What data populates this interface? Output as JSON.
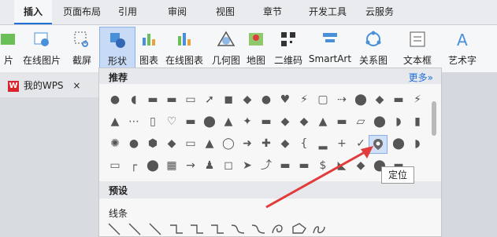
{
  "tabs": [
    "插入",
    "页面布局",
    "引用",
    "审阅",
    "视图",
    "章节",
    "开发工具",
    "云服务"
  ],
  "active_tab": "插入",
  "ribbon": [
    "片",
    "在线图片",
    "截屏",
    "形状",
    "图表",
    "在线图表",
    "几何图",
    "地图",
    "二维码",
    "SmartArt",
    "关系图",
    "文本框",
    "艺术字"
  ],
  "doc_tab": {
    "label": "我的WPS",
    "close": "×"
  },
  "panel": {
    "recommended": "推荐",
    "more": "更多»",
    "preset": "预设",
    "lines": "线条"
  },
  "tooltip": "定位",
  "colors": {
    "accent": "#1e6fd9",
    "arrow": "#e23b3b"
  }
}
